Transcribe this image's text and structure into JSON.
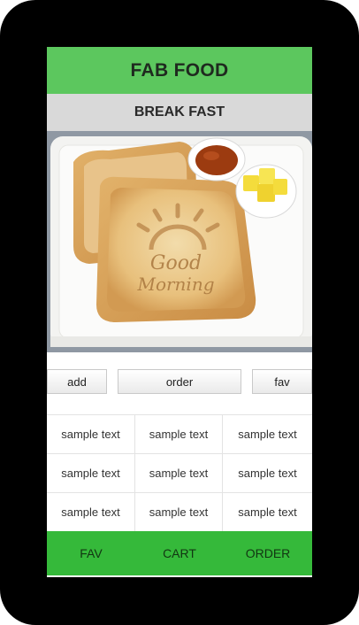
{
  "app": {
    "title": "FAB FOOD"
  },
  "section": {
    "title": "BREAK FAST"
  },
  "hero": {
    "toast_text_line1": "Good",
    "toast_text_line2": "Morning"
  },
  "actions": {
    "add_label": "add",
    "order_label": "order",
    "fav_label": "fav"
  },
  "grid": {
    "rows": [
      [
        "sample text",
        "sample text",
        "sample text"
      ],
      [
        "sample text",
        "sample text",
        "sample text"
      ],
      [
        "sample text",
        "sample text",
        "sample text"
      ]
    ]
  },
  "bottom_nav": {
    "items": [
      {
        "label": "FAV"
      },
      {
        "label": "CART"
      },
      {
        "label": "ORDER"
      }
    ]
  },
  "colors": {
    "header": "#5cc75e",
    "section_bar": "#d9d9d9",
    "bottom_nav": "#35b93a"
  }
}
